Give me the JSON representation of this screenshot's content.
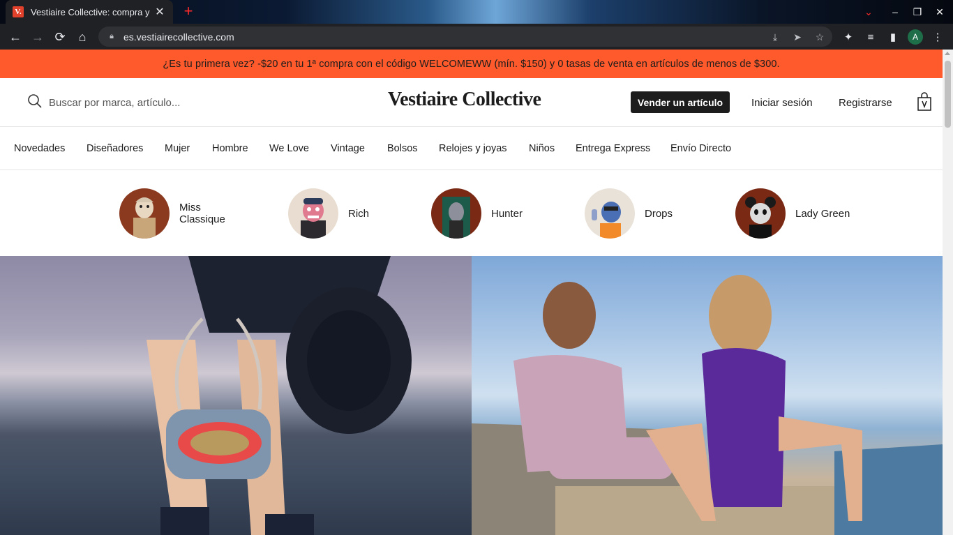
{
  "browser": {
    "tab_title": "Vestiaire Collective: compra y",
    "favicon_letter": "V.",
    "url": "es.vestiairecollective.com",
    "profile_initial": "A"
  },
  "promo_banner": {
    "text": "¿Es tu primera vez? -$20 en tu 1ª compra con el código WELCOMEWW (mín. $150) y 0 tasas de venta en artículos de menos de $300."
  },
  "header": {
    "search_placeholder": "Buscar por marca, artículo...",
    "logo": "Vestiaire Collective",
    "sell_button": "Vender un artículo",
    "login": "Iniciar sesión",
    "register": "Registrarse"
  },
  "nav": {
    "items": [
      {
        "label": "Novedades"
      },
      {
        "label": "Diseñadores"
      },
      {
        "label": "Mujer"
      },
      {
        "label": "Hombre"
      },
      {
        "label": "We Love"
      },
      {
        "label": "Vintage"
      },
      {
        "label": "Bolsos"
      },
      {
        "label": "Relojes y joyas"
      },
      {
        "label": "Niños"
      },
      {
        "label": "Entrega Express"
      },
      {
        "label": "Envío Directo"
      }
    ]
  },
  "stories": [
    {
      "label": "Miss Classique",
      "bg": "#8b3a1f"
    },
    {
      "label": "Rich",
      "bg": "#e8ddd0"
    },
    {
      "label": "Hunter",
      "bg": "#7a2a14"
    },
    {
      "label": "Drops",
      "bg": "#e9e2d8"
    },
    {
      "label": "Lady Green",
      "bg": "#7a2a14"
    }
  ],
  "colors": {
    "promo": "#ff5a2b",
    "primary": "#1c1c1c"
  }
}
